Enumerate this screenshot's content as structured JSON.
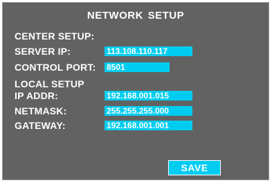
{
  "title": "NETWORK SETUP",
  "center": {
    "heading": "CENTER SETUP:",
    "server_ip_label": "SERVER IP:",
    "server_ip_value": "113.108.110.117",
    "control_port_label": "CONTROL PORT:",
    "control_port_value": "8501"
  },
  "local": {
    "heading": "LOCAL SETUP",
    "ip_label": "IP ADDR:",
    "ip_value": "192.168.001.015",
    "netmask_label": "NETMASK:",
    "netmask_value": "255.255.255.000",
    "gateway_label": "GATEWAY:",
    "gateway_value": "192.168.001.001"
  },
  "save_label": "SAVE",
  "colors": {
    "panel": "#626262",
    "field": "#00ccf0",
    "text": "#ffffff"
  }
}
